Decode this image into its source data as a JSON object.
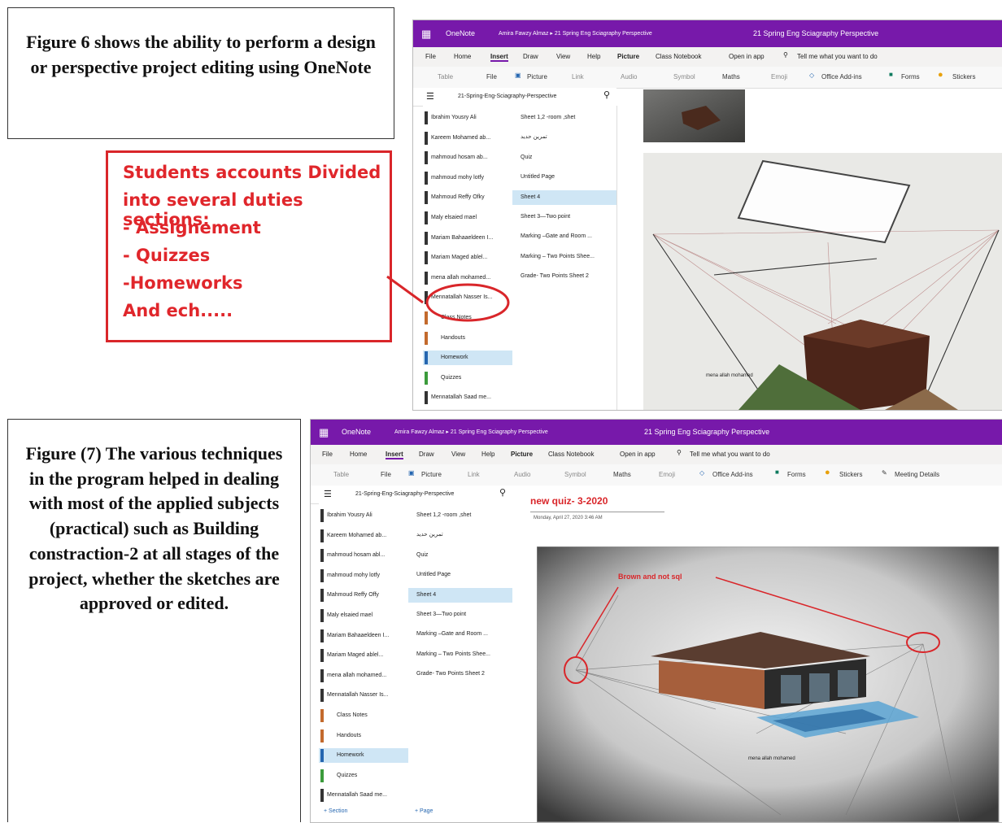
{
  "fig6": {
    "caption": "Figure 6 shows the ability to perform a design or perspective project editing using OneNote",
    "annotation": {
      "line1": "Students accounts Divided",
      "line2": "into several duties sections:",
      "line3": "- Assignement",
      "line4": "- Quizzes",
      "line5": "-Homeworks",
      "line6": "And ech....."
    },
    "window": {
      "app_name": "OneNote",
      "breadcrumb": "Amira Fawzy Almaz ▸ 21 Spring Eng Sciagraphy Perspective",
      "doc_title": "21 Spring Eng Sciagraphy Perspective",
      "menu": [
        "File",
        "Home",
        "Insert",
        "Draw",
        "View",
        "Help",
        "Picture",
        "Class Notebook",
        "Open in app",
        "Tell me what you want to do"
      ],
      "toolbar": [
        "Table",
        "File",
        "Picture",
        "Link",
        "Audio",
        "Symbol",
        "Maths",
        "Emoji",
        "Office Add-ins",
        "Forms",
        "Stickers"
      ],
      "notebook_title": "21-Spring-Eng-Sciagraphy-Perspective",
      "sections": [
        "Ibrahim Yousry Ali",
        "Kareem Mohamed ab...",
        "mahmoud hosam ab...",
        "mahmoud mohy lotfy",
        "Mahmoud Reffy Ofky",
        "Maly elsaied mael",
        "Mariam Bahaaeldeen I...",
        "Mariam Maged ablel...",
        "mena allah mohamed...",
        "Mennatallah Nasser Is...",
        "Class Notes",
        "Handouts",
        "Homework",
        "Quizzes",
        "Mennatallah Saad me..."
      ],
      "pages": [
        "Sheet 1,2 -room ,shet",
        "تمرين حديد",
        "Quiz",
        "Untitled Page",
        "Sheet 4",
        "Sheet 3—Two point",
        "Marking –Gate and Room ...",
        "Marking – Two Points Shee...",
        "Grade- Two Points Sheet 2"
      ],
      "note_label": "mena allah mohamed"
    }
  },
  "fig7": {
    "caption": "Figure (7) The various techniques in the program helped in dealing with most of the applied subjects (practical) such as Building constraction-2 at all stages of the project, whether the sketches are approved or edited.",
    "window": {
      "app_name": "OneNote",
      "breadcrumb": "Amira Fawzy Almaz ▸ 21 Spring Eng Sciagraphy Perspective",
      "doc_title": "21 Spring Eng Sciagraphy Perspective",
      "menu": [
        "File",
        "Home",
        "Insert",
        "Draw",
        "View",
        "Help",
        "Picture",
        "Class Notebook",
        "Open in app",
        "Tell me what you want to do"
      ],
      "toolbar": [
        "Table",
        "File",
        "Picture",
        "Link",
        "Audio",
        "Symbol",
        "Maths",
        "Emoji",
        "Office Add-ins",
        "Forms",
        "Stickers",
        "Meeting Details"
      ],
      "notebook_title": "21-Spring-Eng-Sciagraphy-Perspective",
      "sections": [
        "Ibrahim Yousry Ali",
        "Kareem Mohamed ab...",
        "mahmoud hosam abl...",
        "mahmoud mohy lotfy",
        "Mahmoud Reffy Offy",
        "Maly elsaied mael",
        "Mariam Bahaaeldeen I...",
        "Mariam Maged ablel...",
        "mena allah mohamed...",
        "Mennatallah Nasser Is...",
        "Class Notes",
        "Handouts",
        "Homework",
        "Quizzes",
        "Mennatallah Saad me..."
      ],
      "pages": [
        "Sheet 1,2 -room ,shet",
        "تمرين حديد",
        "Quiz",
        "Untitled Page",
        "Sheet 4",
        "Sheet 3—Two point",
        "Marking –Gate and Room ...",
        "Marking – Two Points Shee...",
        "Grade- Two Points Sheet 2"
      ],
      "add_section": "+ Section",
      "add_page": "+ Page",
      "page_title": "new quiz- 3-2020",
      "page_date": "Monday, April 27, 2020   3:46 AM",
      "sketch_label": "mena allah mohamed",
      "sketch_note": "Brown and not sql"
    }
  },
  "colors": {
    "onenote_purple": "#7719aa",
    "annotation_red": "#e0262b",
    "selection_blue": "#cfe6f5"
  }
}
